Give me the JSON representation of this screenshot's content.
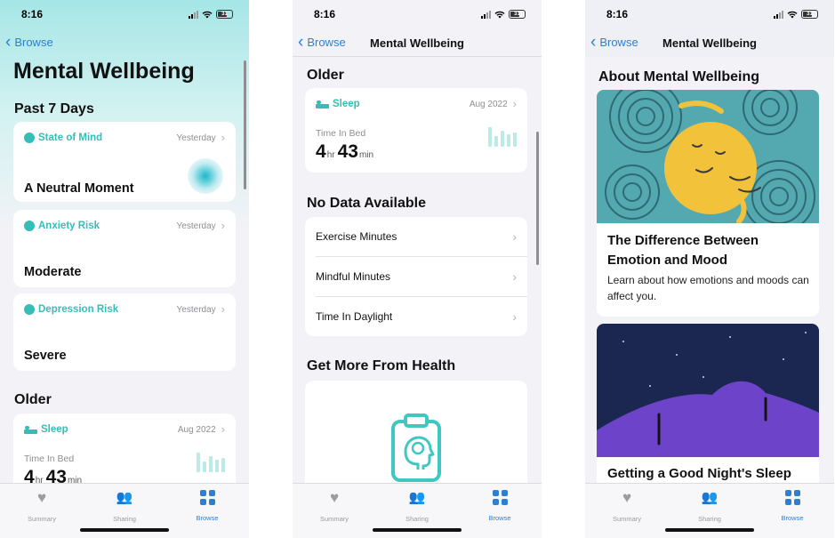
{
  "status": {
    "time": "8:16",
    "battery": "31"
  },
  "nav": {
    "back_label": "Browse",
    "title": "Mental Wellbeing"
  },
  "screen1": {
    "title": "Mental Wellbeing",
    "section_past": "Past 7 Days",
    "state_of_mind": {
      "label": "State of Mind",
      "date": "Yesterday",
      "value": "A Neutral Moment"
    },
    "anxiety": {
      "label": "Anxiety Risk",
      "date": "Yesterday",
      "value": "Moderate"
    },
    "depression": {
      "label": "Depression Risk",
      "date": "Yesterday",
      "value": "Severe"
    },
    "section_older": "Older",
    "sleep": {
      "label": "Sleep",
      "date": "Aug 2022",
      "metric": "Time In Bed",
      "hours": "4",
      "hr_unit": "hr",
      "minutes": "43",
      "min_unit": "min"
    }
  },
  "screen2": {
    "section_older": "Older",
    "sleep": {
      "label": "Sleep",
      "date": "Aug 2022",
      "metric": "Time In Bed",
      "hours": "4",
      "hr_unit": "hr",
      "minutes": "43",
      "min_unit": "min"
    },
    "section_nodata": "No Data Available",
    "nodata_items": [
      "Exercise Minutes",
      "Mindful Minutes",
      "Time In Daylight"
    ],
    "section_more": "Get More From Health"
  },
  "screen3": {
    "section_about": "About Mental Wellbeing",
    "article1": {
      "title": "The Difference Between Emotion and Mood",
      "desc": "Learn about how emotions and moods can affect you."
    },
    "article2": {
      "title": "Getting a Good Night's Sleep"
    }
  },
  "tabs": [
    "Summary",
    "Sharing",
    "Browse"
  ],
  "colors": {
    "accent": "#2f7fd1",
    "teal": "#36bdb8"
  }
}
